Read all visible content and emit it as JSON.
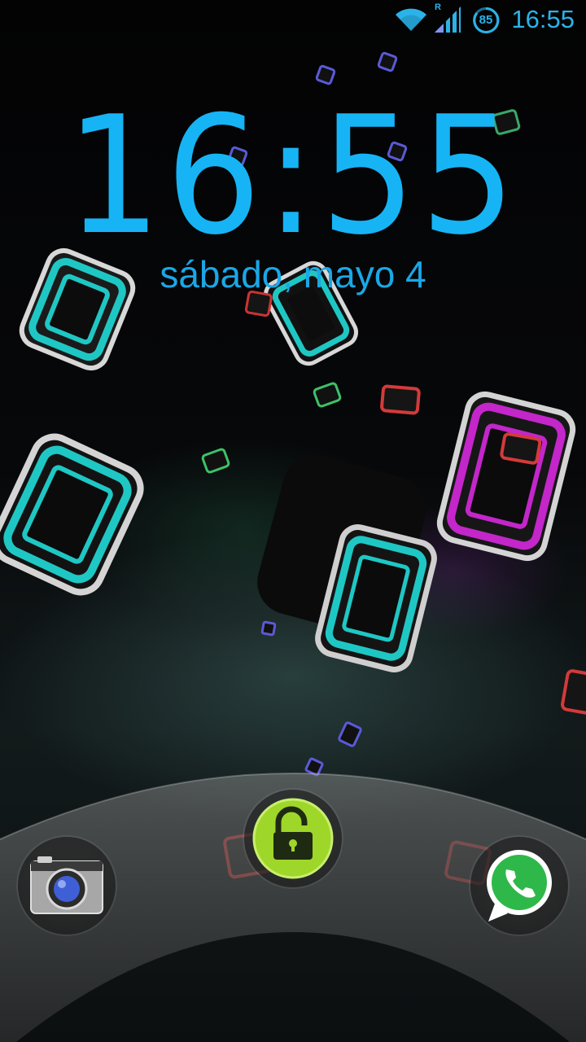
{
  "status_bar": {
    "time": "16:55",
    "battery_level": "85",
    "roaming_indicator": "R",
    "icons": [
      "wifi-icon",
      "signal-icon",
      "battery-icon"
    ]
  },
  "lockscreen": {
    "clock": "16:55",
    "date": "sábado, mayo 4"
  },
  "unlock_targets": [
    {
      "name": "camera-icon",
      "app": "camera"
    },
    {
      "name": "unlock-icon",
      "app": "unlock"
    },
    {
      "name": "whatsapp-icon",
      "app": "whatsapp"
    }
  ],
  "colors": {
    "accent": "#16b4f5",
    "unlock_green": "#9fd62a",
    "whatsapp_green": "#2fb84a"
  }
}
